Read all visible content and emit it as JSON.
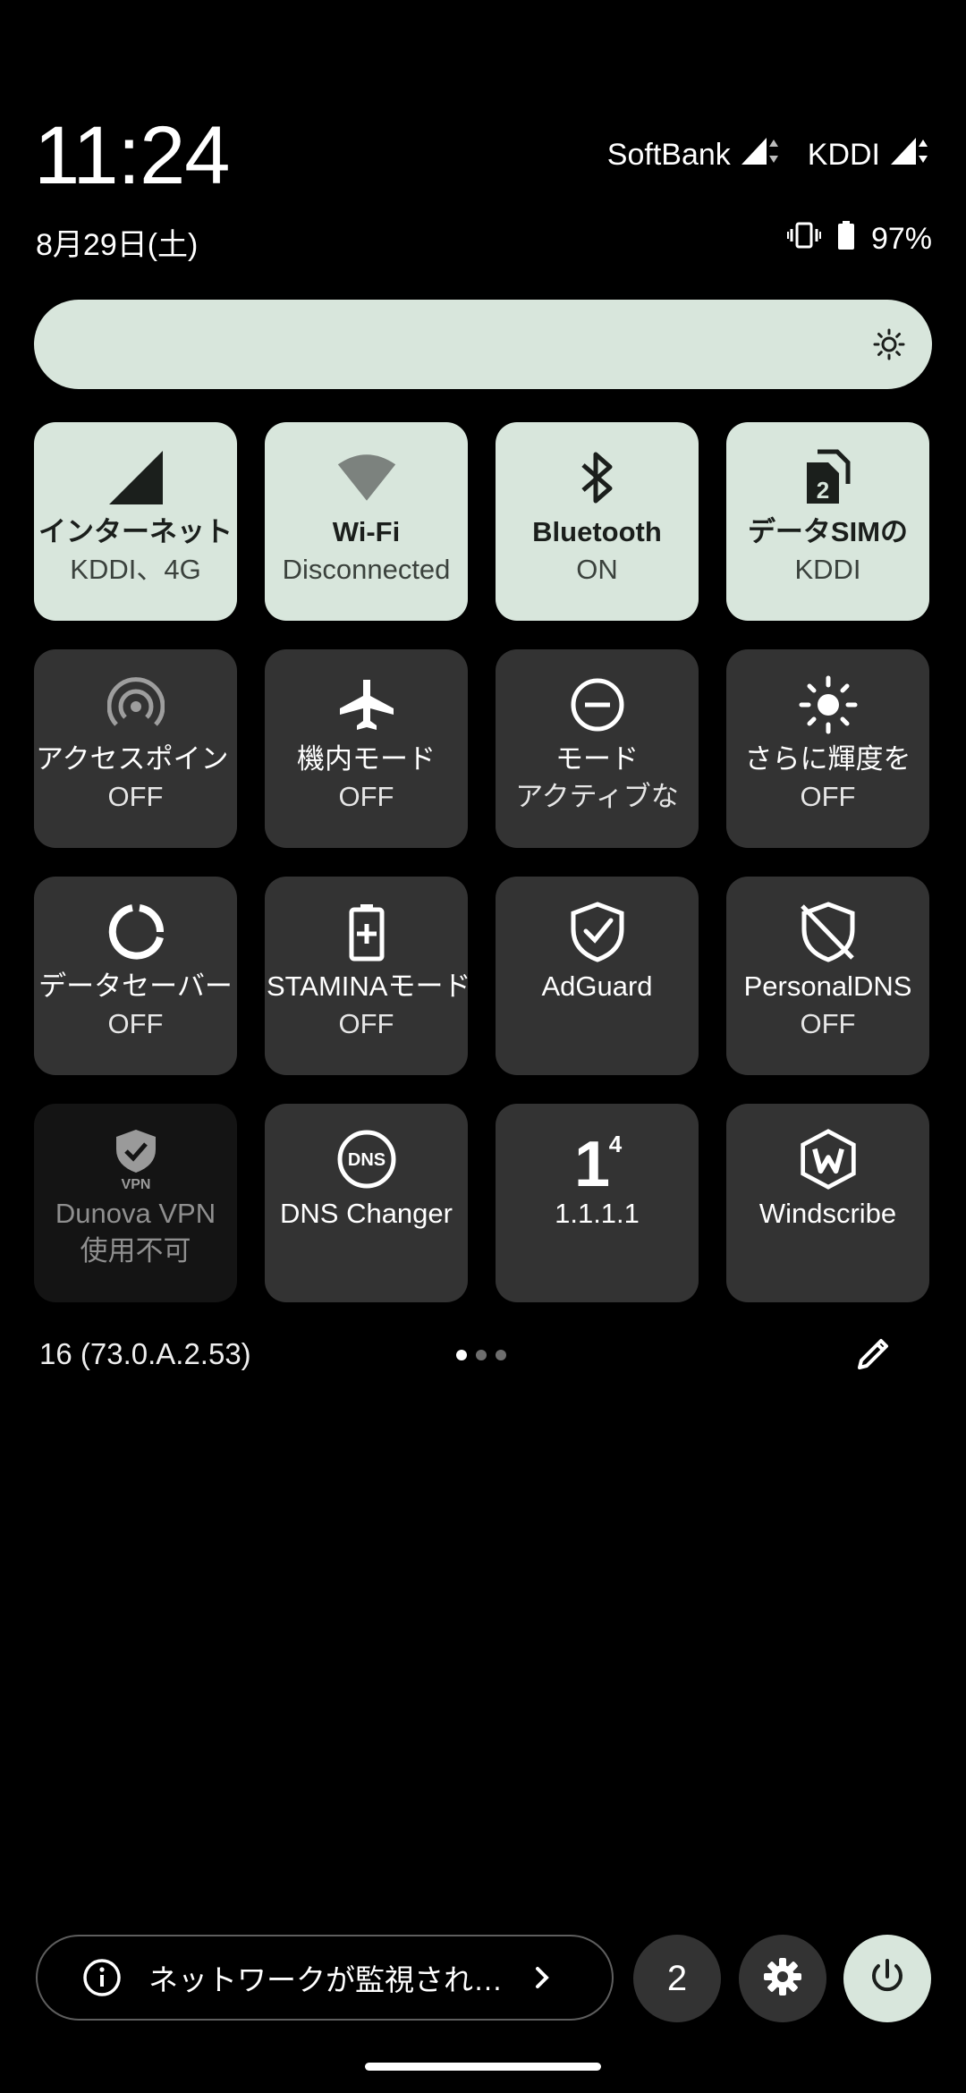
{
  "status_bar": {
    "time": "11:24",
    "date": "8月29日(土)",
    "carriers": [
      {
        "name": "SoftBank"
      },
      {
        "name": "KDDI"
      }
    ],
    "battery": "97%"
  },
  "brightness": {
    "icon": "brightness-auto-icon"
  },
  "tiles": [
    {
      "label": "インターネット",
      "sub": "KDDI、4G",
      "state": "on",
      "icon": "cell-signal-icon"
    },
    {
      "label": "Wi-Fi",
      "sub": "Disconnected",
      "state": "on",
      "icon": "wifi-icon"
    },
    {
      "label": "Bluetooth",
      "sub": "ON",
      "state": "on",
      "icon": "bluetooth-icon"
    },
    {
      "label": "データSIMの",
      "sub": "KDDI",
      "state": "on",
      "icon": "sim-2-icon"
    },
    {
      "label": "アクセスポイント",
      "sub": "OFF",
      "state": "off",
      "icon": "hotspot-icon"
    },
    {
      "label": "機内モード",
      "sub": "OFF",
      "state": "off",
      "icon": "airplane-icon"
    },
    {
      "label": "モード",
      "sub": "アクティブな",
      "state": "off",
      "icon": "do-not-disturb-icon"
    },
    {
      "label": "さらに輝度を",
      "sub": "OFF",
      "state": "off",
      "icon": "extra-brightness-icon"
    },
    {
      "label": "データセーバー",
      "sub": "OFF",
      "state": "off",
      "icon": "data-saver-icon"
    },
    {
      "label": "STAMINAモード",
      "sub": "OFF",
      "state": "off",
      "icon": "stamina-battery-icon"
    },
    {
      "label": "AdGuard",
      "sub": "",
      "state": "off",
      "icon": "adguard-shield-icon"
    },
    {
      "label": "PersonalDNS",
      "sub": "OFF",
      "state": "off",
      "icon": "personaldns-shield-icon"
    },
    {
      "label": "Dunova VPN",
      "sub": "使用不可",
      "state": "disabled",
      "icon": "vpn-shield-icon"
    },
    {
      "label": "DNS Changer",
      "sub": "",
      "state": "off",
      "icon": "dns-icon"
    },
    {
      "label": "1.1.1.1",
      "sub": "",
      "state": "off",
      "icon": "one-one-one-one-icon"
    },
    {
      "label": "Windscribe",
      "sub": "",
      "state": "off",
      "icon": "windscribe-icon"
    }
  ],
  "build": "16 (73.0.A.2.53)",
  "pager": {
    "pages": 3,
    "current": 1
  },
  "footer": {
    "network_notice": "ネットワークが監視され…",
    "count": "2"
  },
  "colors": {
    "tile_on": "#d8e6dc",
    "tile_off": "#333333",
    "tile_disabled": "#141414",
    "background": "#000000"
  }
}
